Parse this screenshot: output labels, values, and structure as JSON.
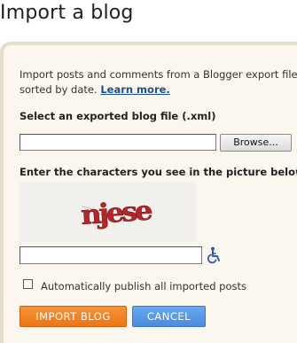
{
  "page": {
    "title": "Import a blog"
  },
  "intro": {
    "line1": "Import posts and comments from a Blogger export file.",
    "line2": "sorted by date.",
    "learn_more": "Learn more."
  },
  "file_select": {
    "label": "Select an exported blog file (.xml)",
    "value": "",
    "browse_label": "Browse..."
  },
  "captcha": {
    "label": "Enter the characters you see in the picture below:",
    "image_text": "njese",
    "input_value": "",
    "accessibility_icon": "wheelchair-icon"
  },
  "options": {
    "autopublish_label": "Automatically publish all imported posts",
    "autopublish_checked": false
  },
  "actions": {
    "import_label": "IMPORT BLOG",
    "cancel_label": "CANCEL"
  },
  "colors": {
    "import_button": "#f0801f",
    "cancel_button": "#5b9be8",
    "panel_background": "#fbf7ef",
    "panel_border": "#e6decb",
    "link": "#1a4f9c"
  }
}
